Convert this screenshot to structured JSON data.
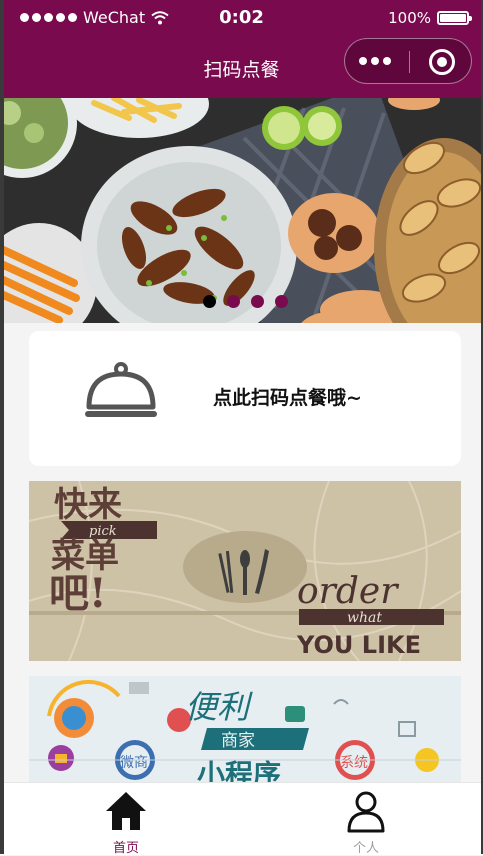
{
  "status_bar": {
    "carrier": "WeChat",
    "time": "0:02",
    "battery": "100%"
  },
  "nav": {
    "title": "扫码点餐"
  },
  "banner": {
    "slide_count": 4,
    "active_index": 0
  },
  "scan_card": {
    "label": "点此扫码点餐哦~",
    "icon": "food-cloche-icon"
  },
  "promo1": {
    "line1": "快来",
    "pick": "pick",
    "line2": "菜单",
    "line3": "吧!",
    "order": "order",
    "what": "what",
    "you_like": "YOU LIKE",
    "icon": "cutlery-icon"
  },
  "promo2": {
    "title": "便利",
    "sub": "商家",
    "tail": "小程序",
    "btn1": "微商",
    "btn2": "系统"
  },
  "tabbar": {
    "items": [
      {
        "label": "首页",
        "icon": "home-icon",
        "active": true
      },
      {
        "label": "个人",
        "icon": "person-icon",
        "active": false
      }
    ]
  },
  "colors": {
    "brand": "#7a0a4e",
    "tab_inactive": "#a0a0a0"
  }
}
